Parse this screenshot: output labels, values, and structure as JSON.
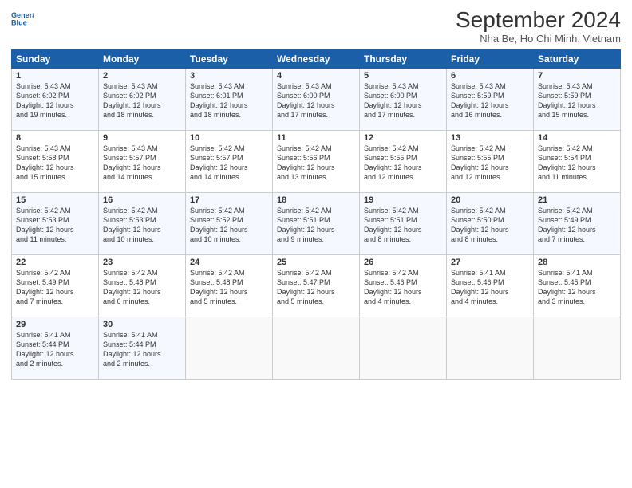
{
  "logo": {
    "line1": "General",
    "line2": "Blue"
  },
  "title": "September 2024",
  "subtitle": "Nha Be, Ho Chi Minh, Vietnam",
  "days_header": [
    "Sunday",
    "Monday",
    "Tuesday",
    "Wednesday",
    "Thursday",
    "Friday",
    "Saturday"
  ],
  "weeks": [
    [
      {
        "day": "1",
        "info": "Sunrise: 5:43 AM\nSunset: 6:02 PM\nDaylight: 12 hours\nand 19 minutes."
      },
      {
        "day": "2",
        "info": "Sunrise: 5:43 AM\nSunset: 6:02 PM\nDaylight: 12 hours\nand 18 minutes."
      },
      {
        "day": "3",
        "info": "Sunrise: 5:43 AM\nSunset: 6:01 PM\nDaylight: 12 hours\nand 18 minutes."
      },
      {
        "day": "4",
        "info": "Sunrise: 5:43 AM\nSunset: 6:00 PM\nDaylight: 12 hours\nand 17 minutes."
      },
      {
        "day": "5",
        "info": "Sunrise: 5:43 AM\nSunset: 6:00 PM\nDaylight: 12 hours\nand 17 minutes."
      },
      {
        "day": "6",
        "info": "Sunrise: 5:43 AM\nSunset: 5:59 PM\nDaylight: 12 hours\nand 16 minutes."
      },
      {
        "day": "7",
        "info": "Sunrise: 5:43 AM\nSunset: 5:59 PM\nDaylight: 12 hours\nand 15 minutes."
      }
    ],
    [
      {
        "day": "8",
        "info": "Sunrise: 5:43 AM\nSunset: 5:58 PM\nDaylight: 12 hours\nand 15 minutes."
      },
      {
        "day": "9",
        "info": "Sunrise: 5:43 AM\nSunset: 5:57 PM\nDaylight: 12 hours\nand 14 minutes."
      },
      {
        "day": "10",
        "info": "Sunrise: 5:42 AM\nSunset: 5:57 PM\nDaylight: 12 hours\nand 14 minutes."
      },
      {
        "day": "11",
        "info": "Sunrise: 5:42 AM\nSunset: 5:56 PM\nDaylight: 12 hours\nand 13 minutes."
      },
      {
        "day": "12",
        "info": "Sunrise: 5:42 AM\nSunset: 5:55 PM\nDaylight: 12 hours\nand 12 minutes."
      },
      {
        "day": "13",
        "info": "Sunrise: 5:42 AM\nSunset: 5:55 PM\nDaylight: 12 hours\nand 12 minutes."
      },
      {
        "day": "14",
        "info": "Sunrise: 5:42 AM\nSunset: 5:54 PM\nDaylight: 12 hours\nand 11 minutes."
      }
    ],
    [
      {
        "day": "15",
        "info": "Sunrise: 5:42 AM\nSunset: 5:53 PM\nDaylight: 12 hours\nand 11 minutes."
      },
      {
        "day": "16",
        "info": "Sunrise: 5:42 AM\nSunset: 5:53 PM\nDaylight: 12 hours\nand 10 minutes."
      },
      {
        "day": "17",
        "info": "Sunrise: 5:42 AM\nSunset: 5:52 PM\nDaylight: 12 hours\nand 10 minutes."
      },
      {
        "day": "18",
        "info": "Sunrise: 5:42 AM\nSunset: 5:51 PM\nDaylight: 12 hours\nand 9 minutes."
      },
      {
        "day": "19",
        "info": "Sunrise: 5:42 AM\nSunset: 5:51 PM\nDaylight: 12 hours\nand 8 minutes."
      },
      {
        "day": "20",
        "info": "Sunrise: 5:42 AM\nSunset: 5:50 PM\nDaylight: 12 hours\nand 8 minutes."
      },
      {
        "day": "21",
        "info": "Sunrise: 5:42 AM\nSunset: 5:49 PM\nDaylight: 12 hours\nand 7 minutes."
      }
    ],
    [
      {
        "day": "22",
        "info": "Sunrise: 5:42 AM\nSunset: 5:49 PM\nDaylight: 12 hours\nand 7 minutes."
      },
      {
        "day": "23",
        "info": "Sunrise: 5:42 AM\nSunset: 5:48 PM\nDaylight: 12 hours\nand 6 minutes."
      },
      {
        "day": "24",
        "info": "Sunrise: 5:42 AM\nSunset: 5:48 PM\nDaylight: 12 hours\nand 5 minutes."
      },
      {
        "day": "25",
        "info": "Sunrise: 5:42 AM\nSunset: 5:47 PM\nDaylight: 12 hours\nand 5 minutes."
      },
      {
        "day": "26",
        "info": "Sunrise: 5:42 AM\nSunset: 5:46 PM\nDaylight: 12 hours\nand 4 minutes."
      },
      {
        "day": "27",
        "info": "Sunrise: 5:41 AM\nSunset: 5:46 PM\nDaylight: 12 hours\nand 4 minutes."
      },
      {
        "day": "28",
        "info": "Sunrise: 5:41 AM\nSunset: 5:45 PM\nDaylight: 12 hours\nand 3 minutes."
      }
    ],
    [
      {
        "day": "29",
        "info": "Sunrise: 5:41 AM\nSunset: 5:44 PM\nDaylight: 12 hours\nand 2 minutes."
      },
      {
        "day": "30",
        "info": "Sunrise: 5:41 AM\nSunset: 5:44 PM\nDaylight: 12 hours\nand 2 minutes."
      },
      {
        "day": "",
        "info": ""
      },
      {
        "day": "",
        "info": ""
      },
      {
        "day": "",
        "info": ""
      },
      {
        "day": "",
        "info": ""
      },
      {
        "day": "",
        "info": ""
      }
    ]
  ]
}
